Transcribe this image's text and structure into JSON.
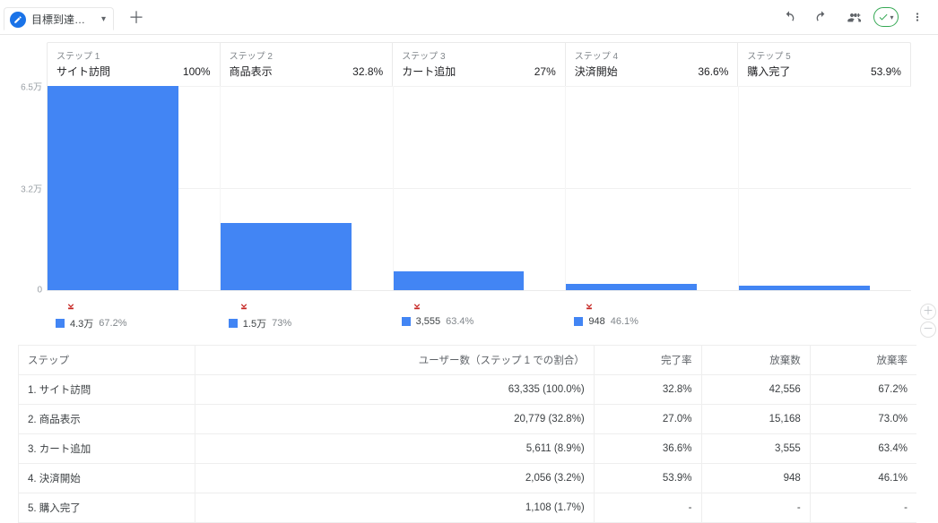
{
  "toolbar": {
    "tab_label": "目標到達プロ…"
  },
  "y_axis": {
    "max_label": "6.5万",
    "mid_label": "3.2万",
    "zero_label": "0",
    "max_value": 65000
  },
  "steps": [
    {
      "num": "ステップ 1",
      "name": "サイト訪問",
      "pct": "100%",
      "users": 63335,
      "bar_h": 1.0,
      "drop_count": "4.3万",
      "drop_pct": "67.2%"
    },
    {
      "num": "ステップ 2",
      "name": "商品表示",
      "pct": "32.8%",
      "users": 20779,
      "bar_h": 0.328,
      "drop_count": "1.5万",
      "drop_pct": "73%"
    },
    {
      "num": "ステップ 3",
      "name": "カート追加",
      "pct": "27%",
      "users": 5611,
      "bar_h": 0.089,
      "drop_count": "3,555",
      "drop_pct": "63.4%"
    },
    {
      "num": "ステップ 4",
      "name": "決済開始",
      "pct": "36.6%",
      "users": 2056,
      "bar_h": 0.032,
      "drop_count": "948",
      "drop_pct": "46.1%"
    },
    {
      "num": "ステップ 5",
      "name": "購入完了",
      "pct": "53.9%",
      "users": 1108,
      "bar_h": 0.017,
      "drop_count": "",
      "drop_pct": ""
    }
  ],
  "table": {
    "headers": {
      "step": "ステップ",
      "users": "ユーザー数（ステップ 1 での割合）",
      "completion": "完了率",
      "abandon_count": "放棄数",
      "abandon_rate": "放棄率"
    },
    "rows": [
      {
        "step": "1. サイト訪問",
        "users": "63,335 (100.0%)",
        "completion": "32.8%",
        "abandon_count": "42,556",
        "abandon_rate": "67.2%"
      },
      {
        "step": "2. 商品表示",
        "users": "20,779 (32.8%)",
        "completion": "27.0%",
        "abandon_count": "15,168",
        "abandon_rate": "73.0%"
      },
      {
        "step": "3. カート追加",
        "users": "5,611 (8.9%)",
        "completion": "36.6%",
        "abandon_count": "3,555",
        "abandon_rate": "63.4%"
      },
      {
        "step": "4. 決済開始",
        "users": "2,056 (3.2%)",
        "completion": "53.9%",
        "abandon_count": "948",
        "abandon_rate": "46.1%"
      },
      {
        "step": "5. 購入完了",
        "users": "1,108 (1.7%)",
        "completion": "-",
        "abandon_count": "-",
        "abandon_rate": "-"
      }
    ]
  },
  "chart_data": {
    "type": "bar",
    "title": "目標到達プロセス (Funnel)",
    "xlabel": "ステップ",
    "ylabel": "ユーザー数",
    "ylim": [
      0,
      65000
    ],
    "categories": [
      "サイト訪問",
      "商品表示",
      "カート追加",
      "決済開始",
      "購入完了"
    ],
    "series": [
      {
        "name": "ユーザー数",
        "values": [
          63335,
          20779,
          5611,
          2056,
          1108
        ]
      }
    ],
    "step_conversion_pct": [
      100,
      32.8,
      27.0,
      36.6,
      53.9
    ],
    "dropoff_count": [
      42556,
      15168,
      3555,
      948,
      null
    ],
    "dropoff_pct": [
      67.2,
      73.0,
      63.4,
      46.1,
      null
    ]
  }
}
